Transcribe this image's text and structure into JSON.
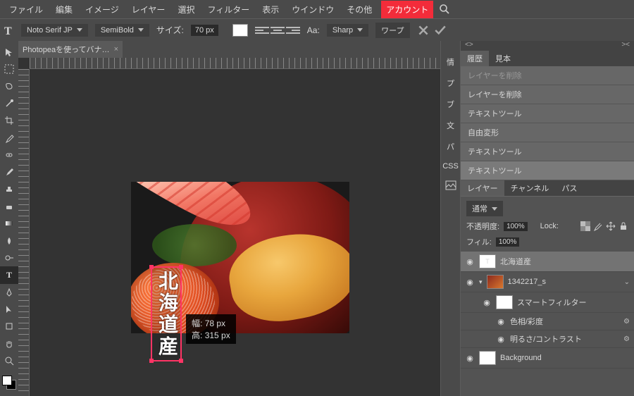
{
  "menu": {
    "items": [
      "ファイル",
      "編集",
      "イメージ",
      "レイヤー",
      "選択",
      "フィルター",
      "表示",
      "ウインドウ",
      "その他"
    ],
    "account": "アカウント"
  },
  "options": {
    "font": "Noto Serif JP",
    "weight": "SemiBold",
    "size_label": "サイズ:",
    "size": "70 px",
    "aa_label": "Aa:",
    "aa": "Sharp",
    "warp": "ワープ"
  },
  "tab": {
    "title": "Photopeaを使ってバナ…"
  },
  "textbox": {
    "content": "北海道産",
    "w_label": "幅:",
    "w": "78 px",
    "h_label": "高:",
    "h": "315 px"
  },
  "side_icons": [
    "情",
    "プ",
    "ブ",
    "文",
    "パ",
    "CSS"
  ],
  "history": {
    "tabs": [
      "履歴",
      "見本"
    ],
    "items": [
      {
        "label": "レイヤーを削除",
        "dim": true
      },
      {
        "label": "レイヤーを削除"
      },
      {
        "label": "テキストツール"
      },
      {
        "label": "自由変形"
      },
      {
        "label": "テキストツール"
      },
      {
        "label": "テキストツール",
        "cur": true
      }
    ]
  },
  "layer_panel": {
    "tabs": [
      "レイヤー",
      "チャンネル",
      "パス"
    ],
    "blend": "通常",
    "opacity_label": "不透明度:",
    "opacity": "100%",
    "lock_label": "Lock:",
    "fill_label": "フィル:",
    "fill": "100%",
    "layers": [
      {
        "name": "北海道産",
        "eye": true,
        "sel": true,
        "type": "text"
      },
      {
        "name": "1342217_s",
        "eye": true,
        "type": "img",
        "expand": true
      },
      {
        "name": "スマートフィルター",
        "eye": true,
        "indent": 1,
        "thumb": "white"
      },
      {
        "name": "色相/彩度",
        "eye": true,
        "indent": 2,
        "gear": true
      },
      {
        "name": "明るさ/コントラスト",
        "eye": true,
        "indent": 2,
        "gear": true
      },
      {
        "name": "Background",
        "eye": true,
        "thumb": "white"
      }
    ]
  }
}
